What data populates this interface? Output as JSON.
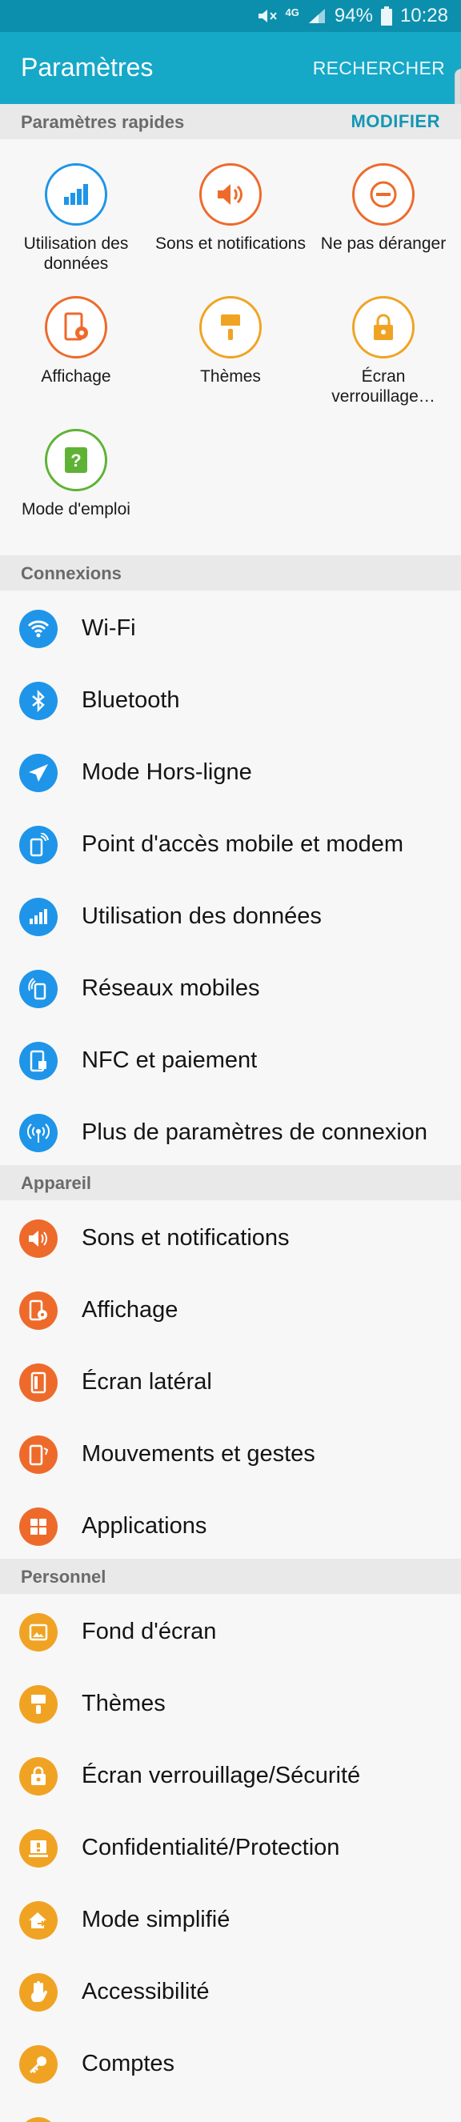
{
  "status": {
    "network": "4G",
    "battery": "94%",
    "time": "10:28"
  },
  "appbar": {
    "title": "Paramètres",
    "search_label": "RECHERCHER"
  },
  "quick": {
    "header": "Paramètres rapides",
    "edit_label": "MODIFIER",
    "items": [
      {
        "label": "Utilisation des données",
        "icon": "data-usage-icon",
        "color": "#1e95e8"
      },
      {
        "label": "Sons et notifications",
        "icon": "sound-icon",
        "color": "#ee6a2b"
      },
      {
        "label": "Ne pas déranger",
        "icon": "do-not-disturb-icon",
        "color": "#ee6a2b"
      },
      {
        "label": "Affichage",
        "icon": "display-icon",
        "color": "#ee6a2b"
      },
      {
        "label": "Thèmes",
        "icon": "themes-icon",
        "color": "#f0a323"
      },
      {
        "label": "Écran verrouillage…",
        "icon": "lock-icon",
        "color": "#f0a323"
      },
      {
        "label": "Mode d'emploi",
        "icon": "help-icon",
        "color": "#5fb235"
      }
    ]
  },
  "sections": {
    "connexions": {
      "header": "Connexions",
      "items": [
        {
          "label": "Wi-Fi",
          "icon": "wifi-icon"
        },
        {
          "label": "Bluetooth",
          "icon": "bluetooth-icon"
        },
        {
          "label": "Mode Hors-ligne",
          "icon": "airplane-icon"
        },
        {
          "label": "Point d'accès mobile et modem",
          "icon": "hotspot-icon"
        },
        {
          "label": "Utilisation des données",
          "icon": "data-usage-icon"
        },
        {
          "label": "Réseaux mobiles",
          "icon": "mobile-networks-icon"
        },
        {
          "label": "NFC et paiement",
          "icon": "nfc-icon"
        },
        {
          "label": "Plus de paramètres de connexion",
          "icon": "more-connections-icon"
        }
      ]
    },
    "appareil": {
      "header": "Appareil",
      "items": [
        {
          "label": "Sons et notifications",
          "icon": "sound-icon"
        },
        {
          "label": "Affichage",
          "icon": "display-icon"
        },
        {
          "label": "Écran latéral",
          "icon": "edge-screen-icon"
        },
        {
          "label": "Mouvements et gestes",
          "icon": "motions-icon"
        },
        {
          "label": "Applications",
          "icon": "apps-icon"
        }
      ]
    },
    "personnel": {
      "header": "Personnel",
      "items": [
        {
          "label": "Fond d'écran",
          "icon": "wallpaper-icon"
        },
        {
          "label": "Thèmes",
          "icon": "themes-icon"
        },
        {
          "label": "Écran verrouillage/Sécurité",
          "icon": "lock-icon"
        },
        {
          "label": "Confidentialité/Protection",
          "icon": "privacy-icon"
        },
        {
          "label": "Mode simplifié",
          "icon": "easy-mode-icon"
        },
        {
          "label": "Accessibilité",
          "icon": "accessibility-icon"
        },
        {
          "label": "Comptes",
          "icon": "accounts-icon"
        }
      ]
    }
  }
}
